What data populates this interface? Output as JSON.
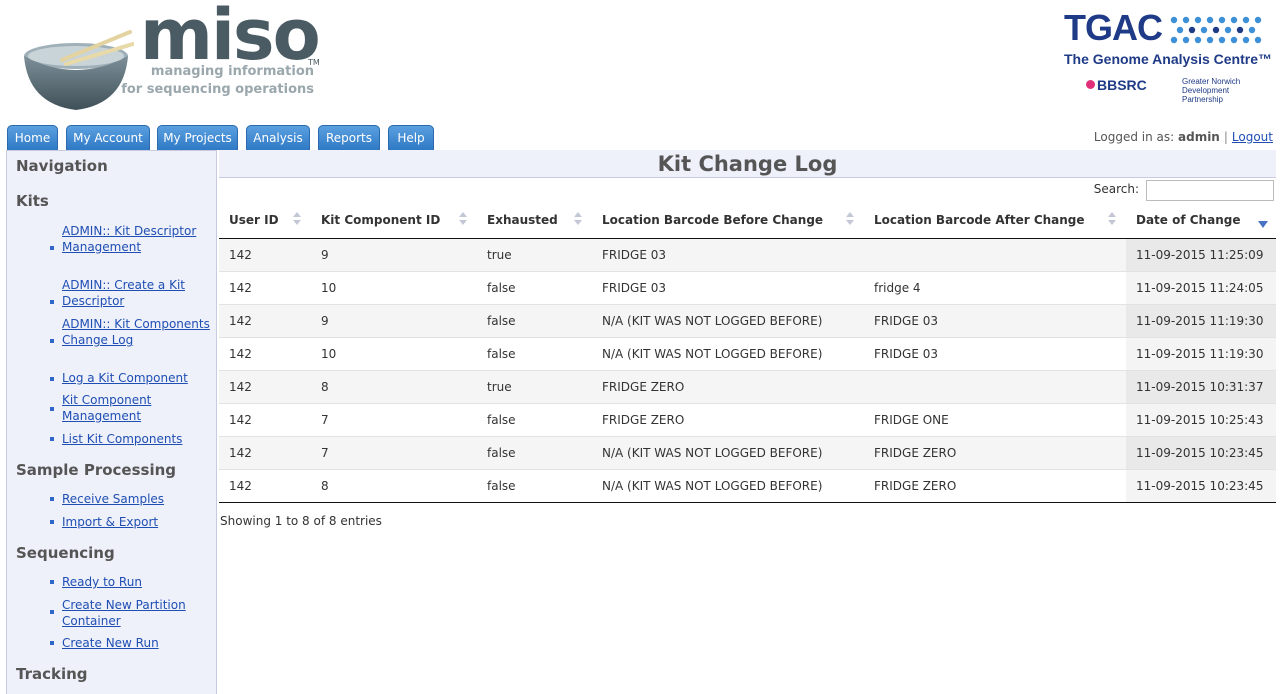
{
  "header": {
    "brand": "miso",
    "trademark": "TM",
    "tagline_1": "managing information",
    "tagline_2": "for sequencing operations",
    "tgac_title": "TGAC",
    "tgac_subtitle": "The Genome Analysis Centre™",
    "bbsrc": "BBSRC",
    "partner": "Greater Norwich Development Partnership"
  },
  "tabs": [
    "Home",
    "My Account",
    "My Projects",
    "Analysis",
    "Reports",
    "Help"
  ],
  "user": {
    "logged_in_label": "Logged in as:",
    "username": "admin",
    "separator": "|",
    "logout": "Logout"
  },
  "sidebar": {
    "navigation_title": "Navigation",
    "sections": [
      {
        "title": "Kits",
        "links": [
          "ADMIN:: Kit Descriptor Management",
          "ADMIN:: Create a Kit Descriptor",
          "ADMIN:: Kit Components Change Log",
          "Log a Kit Component",
          "Kit Component Management",
          "List Kit Components"
        ]
      },
      {
        "title": "Sample Processing",
        "links": [
          "Receive Samples",
          "Import & Export"
        ]
      },
      {
        "title": "Sequencing",
        "links": [
          "Ready to Run",
          "Create New Partition Container",
          "Create New Run"
        ]
      },
      {
        "title": "Tracking",
        "links": []
      }
    ]
  },
  "main": {
    "title": "Kit Change Log",
    "search": {
      "label": "Search:",
      "value": "",
      "placeholder": ""
    },
    "columns": [
      "User ID",
      "Kit Component ID",
      "Exhausted",
      "Location Barcode Before Change",
      "Location Barcode After Change",
      "Date of Change"
    ],
    "sorted_column": "Date of Change",
    "sort_direction": "descending",
    "rows": [
      [
        "142",
        "9",
        "true",
        "FRIDGE 03",
        "",
        "11-09-2015 11:25:09"
      ],
      [
        "142",
        "10",
        "false",
        "FRIDGE 03",
        "fridge 4",
        "11-09-2015 11:24:05"
      ],
      [
        "142",
        "9",
        "false",
        "N/A (KIT WAS NOT LOGGED BEFORE)",
        "FRIDGE 03",
        "11-09-2015 11:19:30"
      ],
      [
        "142",
        "10",
        "false",
        "N/A (KIT WAS NOT LOGGED BEFORE)",
        "FRIDGE 03",
        "11-09-2015 11:19:30"
      ],
      [
        "142",
        "8",
        "true",
        "FRIDGE ZERO",
        "",
        "11-09-2015 10:31:37"
      ],
      [
        "142",
        "7",
        "false",
        "FRIDGE ZERO",
        "FRIDGE ONE",
        "11-09-2015 10:25:43"
      ],
      [
        "142",
        "7",
        "false",
        "N/A (KIT WAS NOT LOGGED BEFORE)",
        "FRIDGE ZERO",
        "11-09-2015 10:23:45"
      ],
      [
        "142",
        "8",
        "false",
        "N/A (KIT WAS NOT LOGGED BEFORE)",
        "FRIDGE ZERO",
        "11-09-2015 10:23:45"
      ]
    ],
    "info": "Showing 1 to 8 of 8 entries"
  }
}
